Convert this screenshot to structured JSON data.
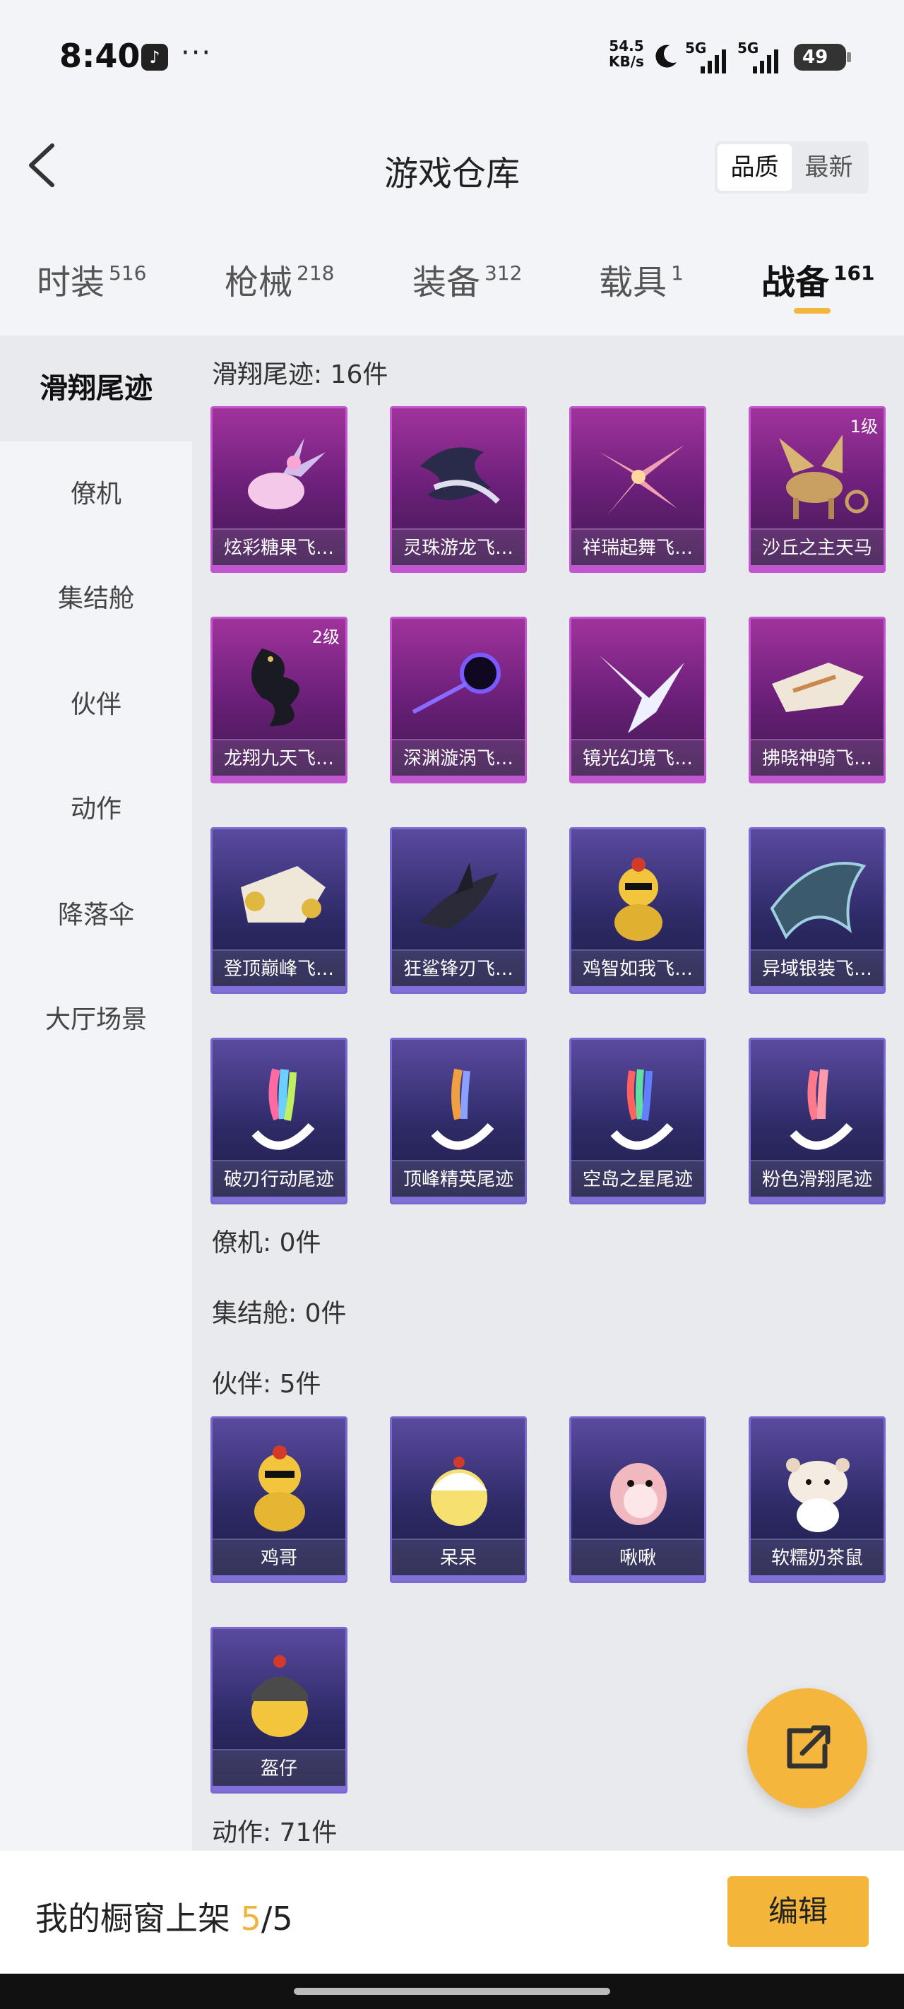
{
  "status": {
    "time": "8:40",
    "dots": "···",
    "speed_value": "54.5",
    "speed_unit": "KB/s",
    "sig1": "5G",
    "sig2": "5G",
    "battery": "49"
  },
  "header": {
    "title": "游戏仓库",
    "sort_quality": "品质",
    "sort_latest": "最新"
  },
  "tabs": [
    {
      "label": "时装",
      "count": "516"
    },
    {
      "label": "枪械",
      "count": "218"
    },
    {
      "label": "装备",
      "count": "312"
    },
    {
      "label": "载具",
      "count": "1"
    },
    {
      "label": "战备",
      "count": "161"
    }
  ],
  "sidebar": [
    {
      "label": "滑翔尾迹"
    },
    {
      "label": "僚机"
    },
    {
      "label": "集结舱"
    },
    {
      "label": "伙伴"
    },
    {
      "label": "动作"
    },
    {
      "label": "降落伞"
    },
    {
      "label": "大厅场景"
    }
  ],
  "sections": {
    "trail_title": "滑翔尾迹: 16件",
    "wingman_title": "僚机: 0件",
    "pod_title": "集结舱: 0件",
    "partner_title": "伙伴: 5件",
    "action_title": "动作: 71件"
  },
  "trail_items": [
    {
      "name": "炫彩糖果飞…",
      "level": "",
      "color": "purple"
    },
    {
      "name": "灵珠游龙飞…",
      "level": "",
      "color": "purple"
    },
    {
      "name": "祥瑞起舞飞…",
      "level": "",
      "color": "purple"
    },
    {
      "name": "沙丘之主天马",
      "level": "1级",
      "color": "purple"
    },
    {
      "name": "龙翔九天飞…",
      "level": "2级",
      "color": "purple"
    },
    {
      "name": "深渊漩涡飞…",
      "level": "",
      "color": "purple"
    },
    {
      "name": "镜光幻境飞…",
      "level": "",
      "color": "purple"
    },
    {
      "name": "拂晓神骑飞…",
      "level": "",
      "color": "purple"
    },
    {
      "name": "登顶巅峰飞…",
      "level": "",
      "color": "blue"
    },
    {
      "name": "狂鲨锋刃飞…",
      "level": "",
      "color": "blue"
    },
    {
      "name": "鸡智如我飞…",
      "level": "",
      "color": "blue"
    },
    {
      "name": "异域银装飞…",
      "level": "",
      "color": "blue"
    },
    {
      "name": "破刃行动尾迹",
      "level": "",
      "color": "blue"
    },
    {
      "name": "顶峰精英尾迹",
      "level": "",
      "color": "blue"
    },
    {
      "name": "空岛之星尾迹",
      "level": "",
      "color": "blue"
    },
    {
      "name": "粉色滑翔尾迹",
      "level": "",
      "color": "blue"
    }
  ],
  "partner_items": [
    {
      "name": "鸡哥"
    },
    {
      "name": "呆呆"
    },
    {
      "name": "啾啾"
    },
    {
      "name": "软糯奶茶鼠"
    },
    {
      "name": "盔仔"
    }
  ],
  "bottom": {
    "shelf_prefix": "我的橱窗上架 ",
    "shelf_current": "5",
    "shelf_total": "/5",
    "edit_label": "编辑"
  },
  "colors": {
    "accent": "#f3b63a",
    "purple_card": "#a0339d",
    "blue_card": "#5a4aa0"
  }
}
